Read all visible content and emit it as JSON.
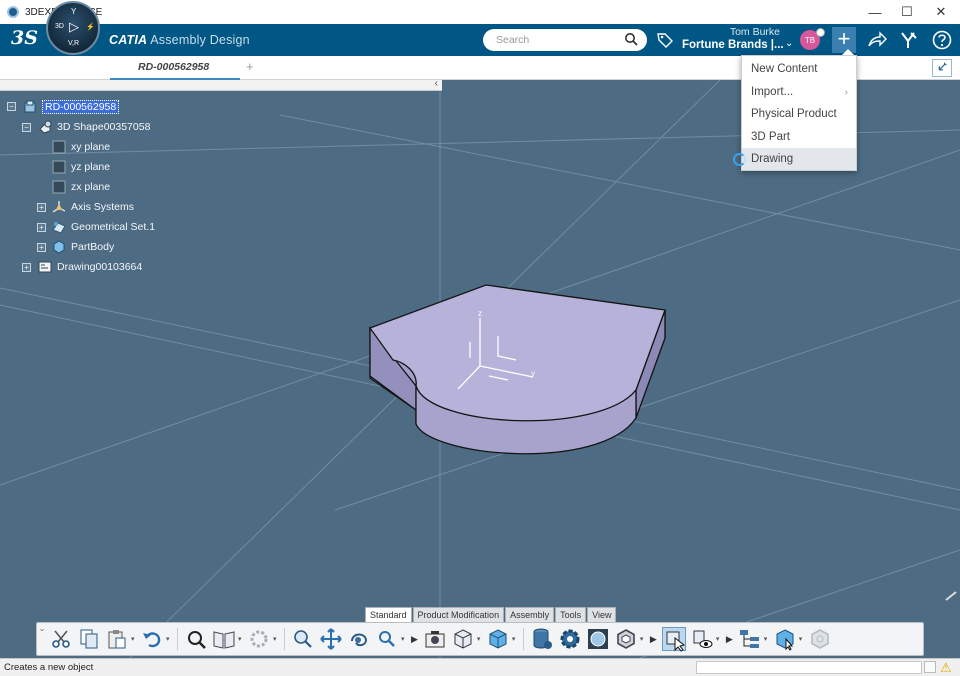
{
  "window": {
    "title": "3DEXPERIENCE",
    "controls": [
      "—",
      "☐",
      "✕"
    ]
  },
  "topbar": {
    "brand": "3S",
    "compass": {
      "top": "Y",
      "left": "3D",
      "right": "⚡",
      "bottom": "V,R"
    },
    "app_title_bold": "CATIA",
    "app_title_light": "Assembly Design",
    "search_placeholder": "Search",
    "user_name": "Tom Burke",
    "tenant": "Fortune Brands |...",
    "avatar_initials": "TB",
    "accent": "#005685"
  },
  "tabs": {
    "active": "RD-000562958",
    "add": "+"
  },
  "tree": {
    "root": "RD-000562958",
    "shape": "3D Shape00357058",
    "children": [
      "xy plane",
      "yz plane",
      "zx plane",
      "Axis Systems",
      "Geometrical Set.1",
      "PartBody"
    ],
    "drawing": "Drawing00103664"
  },
  "menu": {
    "items": [
      "New Content",
      "Import...",
      "Physical Product",
      "3D Part",
      "Drawing"
    ],
    "hovered": "Drawing"
  },
  "triad": {
    "z": "z",
    "y": "y"
  },
  "section_tabs": [
    "Standard",
    "Product Modification",
    "Assembly",
    "Tools",
    "View"
  ],
  "section_tab_active": "View",
  "actionbar_icons": [
    "cut-icon",
    "copy-icon",
    "paste-icon",
    "undo-icon",
    "fit-all-icon",
    "catalog-icon",
    "gear-pattern-icon",
    "zoom-icon",
    "pan-icon",
    "rotate-icon",
    "zoom-area-icon",
    "capture-icon",
    "view-cube-icon",
    "iso-view-icon",
    "database-icon",
    "settings-icon",
    "globe-icon",
    "hexagon-icon",
    "select-icon",
    "hide-show-icon",
    "tree-icon",
    "solid-icon",
    "ghost-icon"
  ],
  "status": {
    "text": "Creates a new object",
    "warning_icon": "warning-icon"
  },
  "colors": {
    "viewport_bg": "#4d6b83",
    "part_fill": "#b7b2d9",
    "selection": "#3b6cd8"
  }
}
